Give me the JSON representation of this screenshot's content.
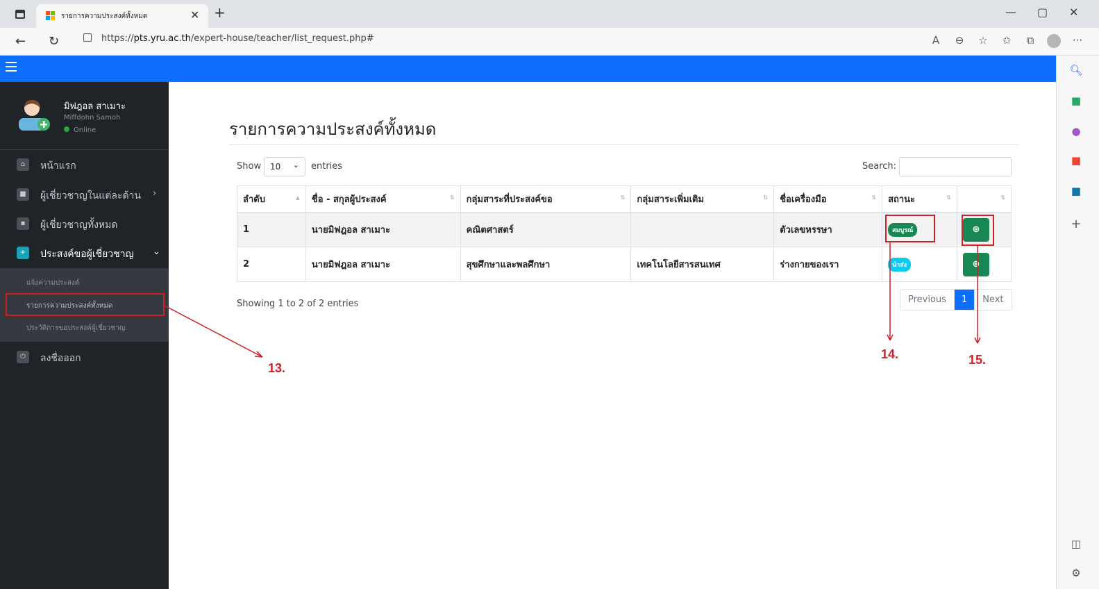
{
  "browser": {
    "tab_title": "รายการความประสงค์ทั้งหมด",
    "url_prefix": "https://",
    "url_host": "pts.yru.ac.th",
    "url_path": "/expert-house/teacher/list_request.php#"
  },
  "user": {
    "name": "มิฟฎอล สาเมาะ",
    "sub": "Miffdohn Samoh",
    "status": "Online"
  },
  "sidebar": {
    "items": [
      {
        "label": "หน้าแรก"
      },
      {
        "label": "ผู้เชี่ยวชาญในแต่ละด้าน"
      },
      {
        "label": "ผู้เชี่ยวชาญทั้งหมด"
      },
      {
        "label": "ประสงค์ขอผู้เชี่ยวชาญ"
      },
      {
        "label": "ลงชื่อออก"
      }
    ],
    "submenu": [
      {
        "label": "แจ้งความประสงค์"
      },
      {
        "label": "รายการความประสงค์ทั้งหมด"
      },
      {
        "label": "ประวัติการขอประสงค์ผู้เชี่ยวชาญ"
      }
    ]
  },
  "page": {
    "title": "รายการความประสงค์ทั้งหมด",
    "show_label": "Show",
    "page_length": "10",
    "entries_label": "entries",
    "search_label": "Search:",
    "info": "Showing 1 to 2 of 2 entries",
    "pager": {
      "previous": "Previous",
      "current": "1",
      "next": "Next"
    }
  },
  "table": {
    "columns": [
      "ลำดับ",
      "ชื่อ - สกุลผู้ประสงค์",
      "กลุ่มสาระที่ประสงค์ขอ",
      "กลุ่มสาระเพิ่มเติม",
      "ชื่อเครื่องมือ",
      "สถานะ",
      ""
    ],
    "rows": [
      {
        "no": "1",
        "name": "นายมิฟฎอล สาเมาะ",
        "subject": "คณิตศาสตร์",
        "extra": "",
        "tool": "ตัวเลขหรรษา",
        "status": "สมบูรณ์",
        "status_color": "#198754"
      },
      {
        "no": "2",
        "name": "นายมิฟฎอล สาเมาะ",
        "subject": "สุขศึกษาและพลศึกษา",
        "extra": "เทคโนโลยีสารสนเทศ",
        "tool": "ร่างกายของเรา",
        "status": "นำส่ง",
        "status_color": "#0dcaf0"
      }
    ]
  },
  "annotations": {
    "a13": "13.",
    "a14": "14.",
    "a15": "15."
  },
  "colors": {
    "topbar": "#0d6efd",
    "sidebar": "#1f2428",
    "annotation": "#d01f25"
  }
}
